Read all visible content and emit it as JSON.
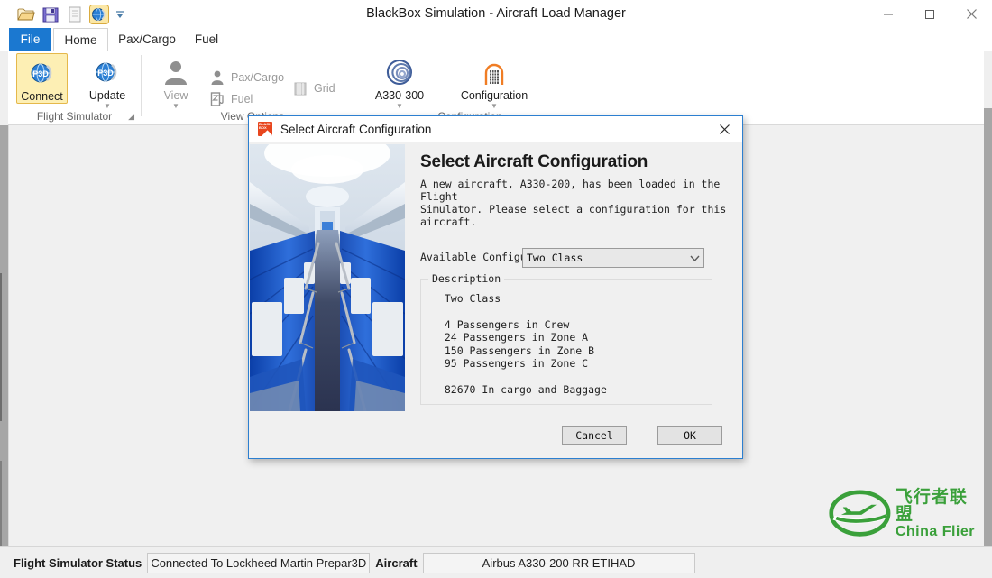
{
  "window": {
    "title": "BlackBox Simulation - Aircraft Load Manager",
    "minimize_label": "—",
    "maximize_label": "☐",
    "close_label": "✕"
  },
  "quick_access": {
    "items": [
      {
        "name": "open-icon",
        "label": "Open"
      },
      {
        "name": "save-icon",
        "label": "Save"
      },
      {
        "name": "document-icon",
        "label": "Report"
      },
      {
        "name": "connect-globe-icon",
        "label": "Connect"
      },
      {
        "name": "customize-qat-icon",
        "label": "Customize Quick Access Toolbar"
      }
    ]
  },
  "ribbon": {
    "tabs": [
      {
        "id": "file",
        "label": "File"
      },
      {
        "id": "home",
        "label": "Home"
      },
      {
        "id": "paxcargo",
        "label": "Pax/Cargo"
      },
      {
        "id": "fuel",
        "label": "Fuel"
      }
    ],
    "groups": [
      {
        "id": "flight-simulator",
        "label": "Flight Simulator",
        "buttons": [
          {
            "id": "connect",
            "label": "Connect",
            "icon": "p3d-globe-icon"
          },
          {
            "id": "update",
            "label": "Update",
            "icon": "p3d-globe-icon"
          }
        ]
      },
      {
        "id": "view-options",
        "label": "View Options",
        "buttons": [
          {
            "id": "view",
            "label": "View",
            "icon": "person-icon"
          },
          {
            "id": "paxcargo",
            "label": "Pax/Cargo",
            "icon": "person-small-icon"
          },
          {
            "id": "fuel",
            "label": "Fuel",
            "icon": "fuel-pump-icon"
          },
          {
            "id": "grid",
            "label": "Grid",
            "icon": "grid-icon"
          }
        ]
      },
      {
        "id": "configuration",
        "label": "Configuration",
        "buttons": [
          {
            "id": "aircraft",
            "label": "A330-300",
            "icon": "swirl-icon"
          },
          {
            "id": "configuration",
            "label": "Configuration",
            "icon": "cabin-arch-icon"
          }
        ]
      }
    ]
  },
  "dialog": {
    "titlebar_title": "Select Aircraft Configuration",
    "close_label": "✕",
    "heading": "Select Aircraft Configuration",
    "intro": "A new aircraft, A330-200, has been loaded in the Flight\nSimulator. Please select a configuration for this\naircraft.",
    "photo_alt": "aircraft-cabin-interior",
    "config_label": "Available Configurations",
    "config_value": "Two Class",
    "config_arrow": "⌄",
    "description_legend": "Description",
    "description_text": "  Two Class\n\n  4 Passengers in Crew\n  24 Passengers in Zone A\n  150 Passengers in Zone B\n  95 Passengers in Zone C\n\n  82670 In cargo and Baggage",
    "cancel_label": "Cancel",
    "ok_label": "OK"
  },
  "status_bar": {
    "fs_status_label": "Flight Simulator Status",
    "fs_status_value": "Connected To Lockheed Martin Prepar3D",
    "aircraft_label": "Aircraft",
    "aircraft_value": "Airbus A330-200 RR ETIHAD"
  },
  "watermark": {
    "chinese": "飞行者联盟",
    "english": "China Flier",
    "color": "#3aa03a"
  },
  "colors": {
    "accent_tab": "#1b78d0",
    "dialog_border": "#2c7fd0",
    "selected_button": "#fdefb4",
    "brand_orange": "#e8461e"
  }
}
